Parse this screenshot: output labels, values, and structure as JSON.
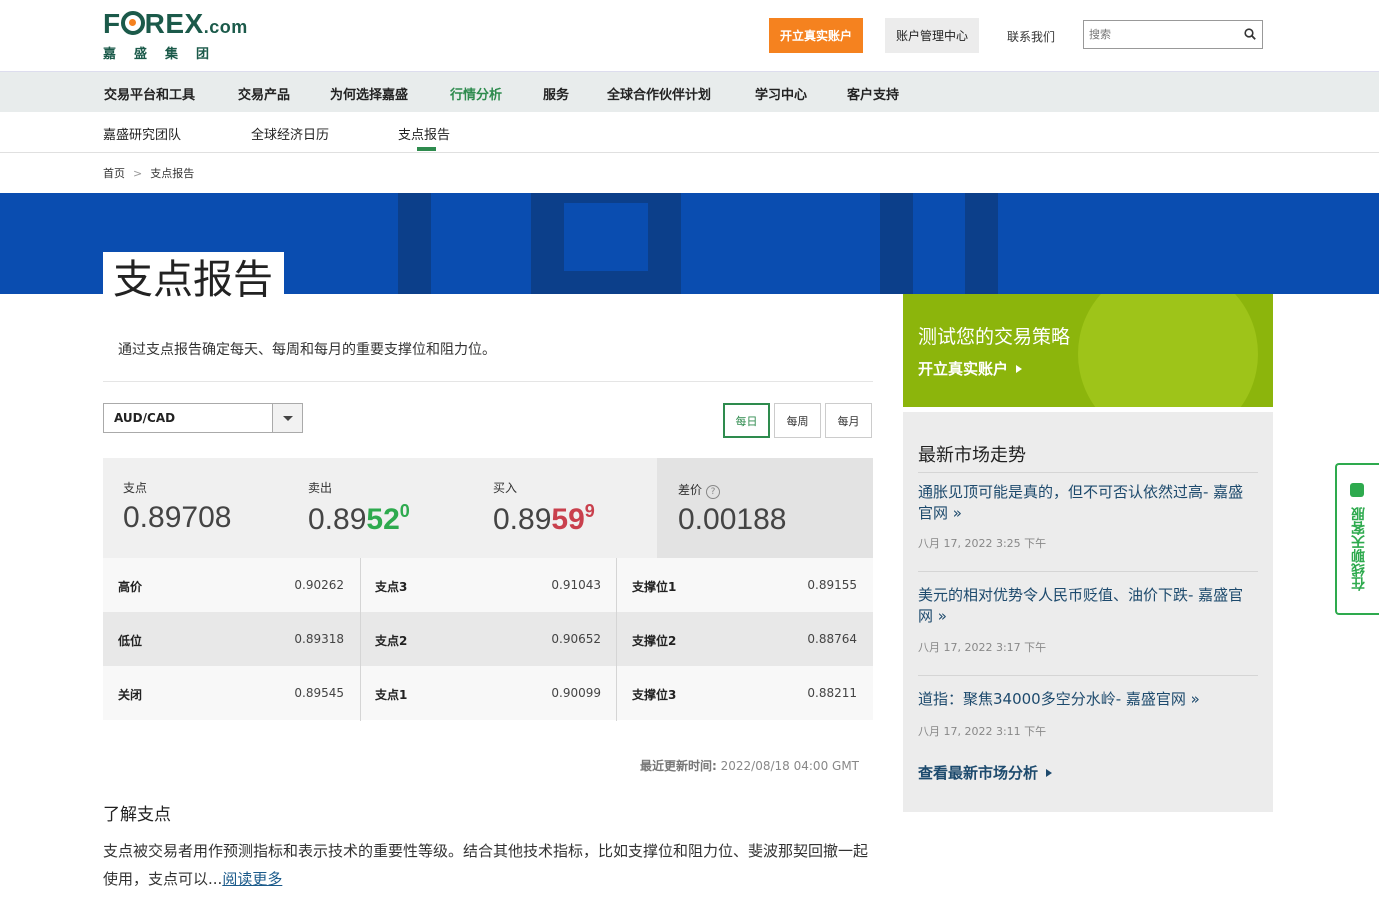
{
  "header": {
    "logo_main": "F",
    "logo_rest": "REX",
    "logo_com": ".com",
    "logo_sub": "嘉盛集团",
    "open_account": "开立真实账户",
    "account_center": "账户管理中心",
    "contact": "联系我们",
    "search_placeholder": "搜索"
  },
  "main_nav": [
    {
      "label": "交易平台和工具"
    },
    {
      "label": "交易产品"
    },
    {
      "label": "为何选择嘉盛"
    },
    {
      "label": "行情分析",
      "active": true
    },
    {
      "label": "服务"
    },
    {
      "label": "全球合作伙伴计划"
    },
    {
      "label": "学习中心"
    },
    {
      "label": "客户支持"
    }
  ],
  "sub_nav": [
    {
      "label": "嘉盛研究团队"
    },
    {
      "label": "全球经济日历"
    },
    {
      "label": "支点报告",
      "active": true
    }
  ],
  "breadcrumb": {
    "home": "首页",
    "sep": ">",
    "current": "支点报告"
  },
  "page": {
    "title": "支点报告",
    "intro": "通过支点报告确定每天、每周和每月的重要支撑位和阻力位。"
  },
  "selector": {
    "pair": "AUD/CAD",
    "periods": [
      {
        "label": "每日",
        "active": true
      },
      {
        "label": "每周"
      },
      {
        "label": "每月"
      }
    ]
  },
  "quote": {
    "pivot_label": "支点",
    "pivot_value": "0.89708",
    "sell_label": "卖出",
    "sell_prefix": "0.89",
    "sell_big": "52",
    "sell_sup": "0",
    "buy_label": "买入",
    "buy_prefix": "0.89",
    "buy_big": "59",
    "buy_sup": "9",
    "spread_label": "差价",
    "spread_help": "?",
    "spread_value": "0.00188"
  },
  "levels": [
    [
      {
        "label": "高价",
        "value": "0.90262"
      },
      {
        "label": "支点3",
        "value": "0.91043"
      },
      {
        "label": "支撑位1",
        "value": "0.89155"
      }
    ],
    [
      {
        "label": "低位",
        "value": "0.89318"
      },
      {
        "label": "支点2",
        "value": "0.90652"
      },
      {
        "label": "支撑位2",
        "value": "0.88764"
      }
    ],
    [
      {
        "label": "关闭",
        "value": "0.89545"
      },
      {
        "label": "支点1",
        "value": "0.90099"
      },
      {
        "label": "支撑位3",
        "value": "0.88211"
      }
    ]
  ],
  "updated": {
    "label": "最近更新时间:",
    "value": "2022/08/18 04:00 GMT"
  },
  "learn": {
    "title": "了解支点",
    "text": "支点被交易者用作预测指标和表示技术的重要性等级。结合其他技术指标，比如支撑位和阻力位、斐波那契回撤一起使用，支点可以...",
    "link": "阅读更多"
  },
  "promo": {
    "title": "测试您的交易策略",
    "link": "开立真实账户"
  },
  "market": {
    "title": "最新市场走势",
    "news": [
      {
        "title": "通胀见顶可能是真的，但不可否认依然过高- 嘉盛官网 »",
        "date": "八月 17, 2022 3:25 下午"
      },
      {
        "title": "美元的相对优势令人民币贬值、油价下跌- 嘉盛官网 »",
        "date": "八月 17, 2022 3:17 下午"
      },
      {
        "title": "道指：聚焦34000多空分水岭- 嘉盛官网 »",
        "date": "八月 17, 2022 3:11 下午"
      }
    ],
    "more": "查看最新市场分析"
  },
  "chat": {
    "label": "在线聊天客服"
  },
  "colors": {
    "brand": "#1b5a4a",
    "accent_orange": "#f5821f",
    "green": "#2e8b4e",
    "banner_blue": "#0a4db0",
    "promo_green": "#8cb50c"
  }
}
